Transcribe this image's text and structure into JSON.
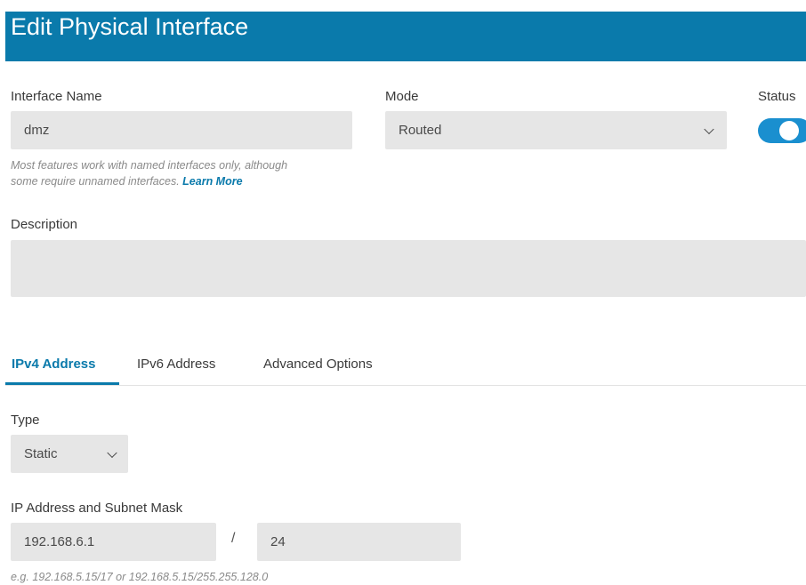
{
  "header": {
    "title": "Edit Physical Interface",
    "color": "#0a7aab"
  },
  "interface_name": {
    "label": "Interface Name",
    "value": "dmz",
    "hint_line1": "Most features work with named interfaces only, although",
    "hint_line2": "some require unnamed interfaces.",
    "learn_more": "Learn More"
  },
  "mode": {
    "label": "Mode",
    "value": "Routed"
  },
  "status": {
    "label": "Status",
    "enabled": true
  },
  "description": {
    "label": "Description",
    "value": ""
  },
  "tabs": [
    {
      "label": "IPv4 Address",
      "active": true
    },
    {
      "label": "IPv6 Address",
      "active": false
    },
    {
      "label": "Advanced Options",
      "active": false
    }
  ],
  "type": {
    "label": "Type",
    "value": "Static"
  },
  "ip": {
    "label": "IP Address and Subnet Mask",
    "address": "192.168.6.1",
    "separator": "/",
    "mask": "24",
    "hint": "e.g. 192.168.5.15/17 or 192.168.5.15/255.255.128.0"
  }
}
